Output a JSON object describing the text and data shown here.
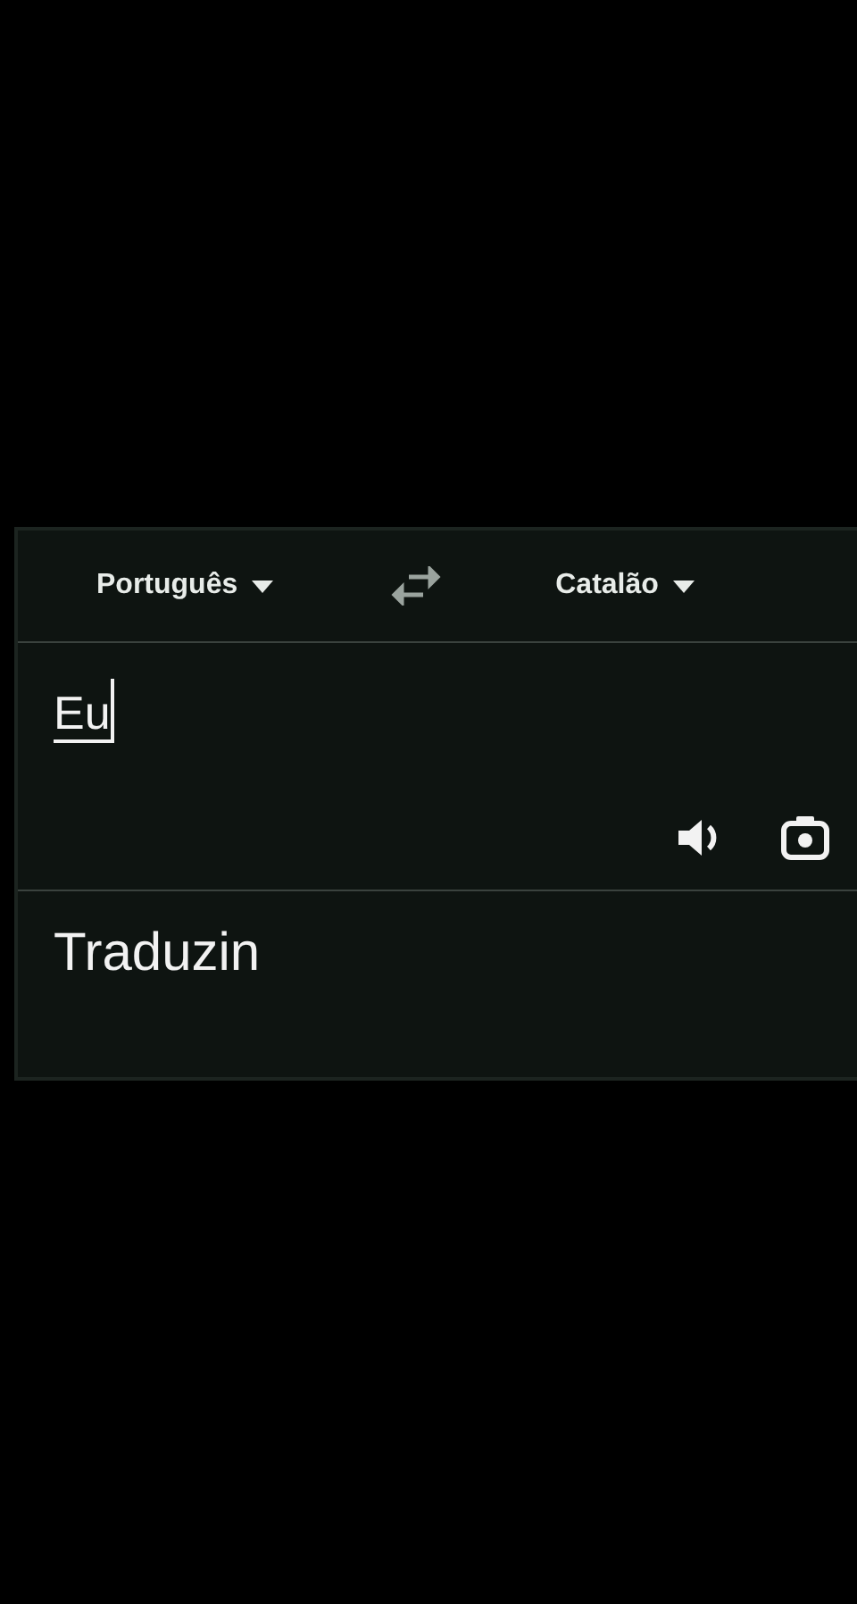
{
  "languages": {
    "source": "Português",
    "target": "Catalão"
  },
  "input": {
    "value": "Eu"
  },
  "output": {
    "text": "Traduzin"
  }
}
